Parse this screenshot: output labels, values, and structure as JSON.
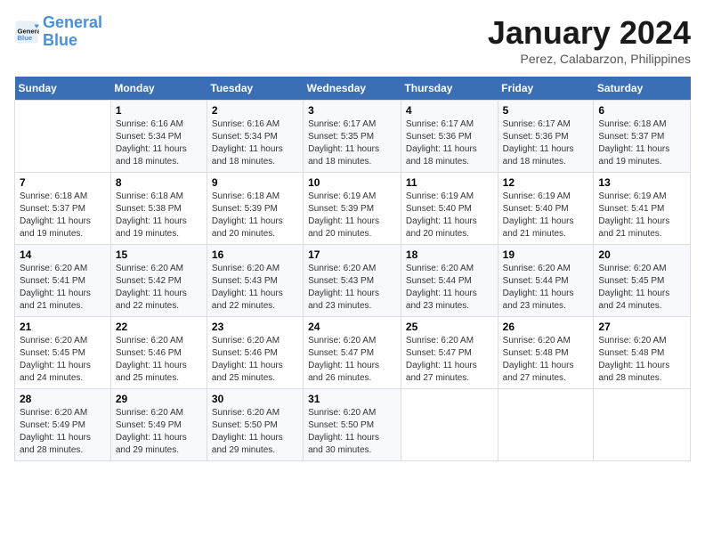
{
  "header": {
    "logo_text_1": "General",
    "logo_text_2": "Blue",
    "title": "January 2024",
    "location": "Perez, Calabarzon, Philippines"
  },
  "weekdays": [
    "Sunday",
    "Monday",
    "Tuesday",
    "Wednesday",
    "Thursday",
    "Friday",
    "Saturday"
  ],
  "weeks": [
    [
      {
        "day": "",
        "info": ""
      },
      {
        "day": "1",
        "info": "Sunrise: 6:16 AM\nSunset: 5:34 PM\nDaylight: 11 hours and 18 minutes."
      },
      {
        "day": "2",
        "info": "Sunrise: 6:16 AM\nSunset: 5:34 PM\nDaylight: 11 hours and 18 minutes."
      },
      {
        "day": "3",
        "info": "Sunrise: 6:17 AM\nSunset: 5:35 PM\nDaylight: 11 hours and 18 minutes."
      },
      {
        "day": "4",
        "info": "Sunrise: 6:17 AM\nSunset: 5:36 PM\nDaylight: 11 hours and 18 minutes."
      },
      {
        "day": "5",
        "info": "Sunrise: 6:17 AM\nSunset: 5:36 PM\nDaylight: 11 hours and 18 minutes."
      },
      {
        "day": "6",
        "info": "Sunrise: 6:18 AM\nSunset: 5:37 PM\nDaylight: 11 hours and 19 minutes."
      }
    ],
    [
      {
        "day": "7",
        "info": "Sunrise: 6:18 AM\nSunset: 5:37 PM\nDaylight: 11 hours and 19 minutes."
      },
      {
        "day": "8",
        "info": "Sunrise: 6:18 AM\nSunset: 5:38 PM\nDaylight: 11 hours and 19 minutes."
      },
      {
        "day": "9",
        "info": "Sunrise: 6:18 AM\nSunset: 5:39 PM\nDaylight: 11 hours and 20 minutes."
      },
      {
        "day": "10",
        "info": "Sunrise: 6:19 AM\nSunset: 5:39 PM\nDaylight: 11 hours and 20 minutes."
      },
      {
        "day": "11",
        "info": "Sunrise: 6:19 AM\nSunset: 5:40 PM\nDaylight: 11 hours and 20 minutes."
      },
      {
        "day": "12",
        "info": "Sunrise: 6:19 AM\nSunset: 5:40 PM\nDaylight: 11 hours and 21 minutes."
      },
      {
        "day": "13",
        "info": "Sunrise: 6:19 AM\nSunset: 5:41 PM\nDaylight: 11 hours and 21 minutes."
      }
    ],
    [
      {
        "day": "14",
        "info": "Sunrise: 6:20 AM\nSunset: 5:41 PM\nDaylight: 11 hours and 21 minutes."
      },
      {
        "day": "15",
        "info": "Sunrise: 6:20 AM\nSunset: 5:42 PM\nDaylight: 11 hours and 22 minutes."
      },
      {
        "day": "16",
        "info": "Sunrise: 6:20 AM\nSunset: 5:43 PM\nDaylight: 11 hours and 22 minutes."
      },
      {
        "day": "17",
        "info": "Sunrise: 6:20 AM\nSunset: 5:43 PM\nDaylight: 11 hours and 23 minutes."
      },
      {
        "day": "18",
        "info": "Sunrise: 6:20 AM\nSunset: 5:44 PM\nDaylight: 11 hours and 23 minutes."
      },
      {
        "day": "19",
        "info": "Sunrise: 6:20 AM\nSunset: 5:44 PM\nDaylight: 11 hours and 23 minutes."
      },
      {
        "day": "20",
        "info": "Sunrise: 6:20 AM\nSunset: 5:45 PM\nDaylight: 11 hours and 24 minutes."
      }
    ],
    [
      {
        "day": "21",
        "info": "Sunrise: 6:20 AM\nSunset: 5:45 PM\nDaylight: 11 hours and 24 minutes."
      },
      {
        "day": "22",
        "info": "Sunrise: 6:20 AM\nSunset: 5:46 PM\nDaylight: 11 hours and 25 minutes."
      },
      {
        "day": "23",
        "info": "Sunrise: 6:20 AM\nSunset: 5:46 PM\nDaylight: 11 hours and 25 minutes."
      },
      {
        "day": "24",
        "info": "Sunrise: 6:20 AM\nSunset: 5:47 PM\nDaylight: 11 hours and 26 minutes."
      },
      {
        "day": "25",
        "info": "Sunrise: 6:20 AM\nSunset: 5:47 PM\nDaylight: 11 hours and 27 minutes."
      },
      {
        "day": "26",
        "info": "Sunrise: 6:20 AM\nSunset: 5:48 PM\nDaylight: 11 hours and 27 minutes."
      },
      {
        "day": "27",
        "info": "Sunrise: 6:20 AM\nSunset: 5:48 PM\nDaylight: 11 hours and 28 minutes."
      }
    ],
    [
      {
        "day": "28",
        "info": "Sunrise: 6:20 AM\nSunset: 5:49 PM\nDaylight: 11 hours and 28 minutes."
      },
      {
        "day": "29",
        "info": "Sunrise: 6:20 AM\nSunset: 5:49 PM\nDaylight: 11 hours and 29 minutes."
      },
      {
        "day": "30",
        "info": "Sunrise: 6:20 AM\nSunset: 5:50 PM\nDaylight: 11 hours and 29 minutes."
      },
      {
        "day": "31",
        "info": "Sunrise: 6:20 AM\nSunset: 5:50 PM\nDaylight: 11 hours and 30 minutes."
      },
      {
        "day": "",
        "info": ""
      },
      {
        "day": "",
        "info": ""
      },
      {
        "day": "",
        "info": ""
      }
    ]
  ]
}
